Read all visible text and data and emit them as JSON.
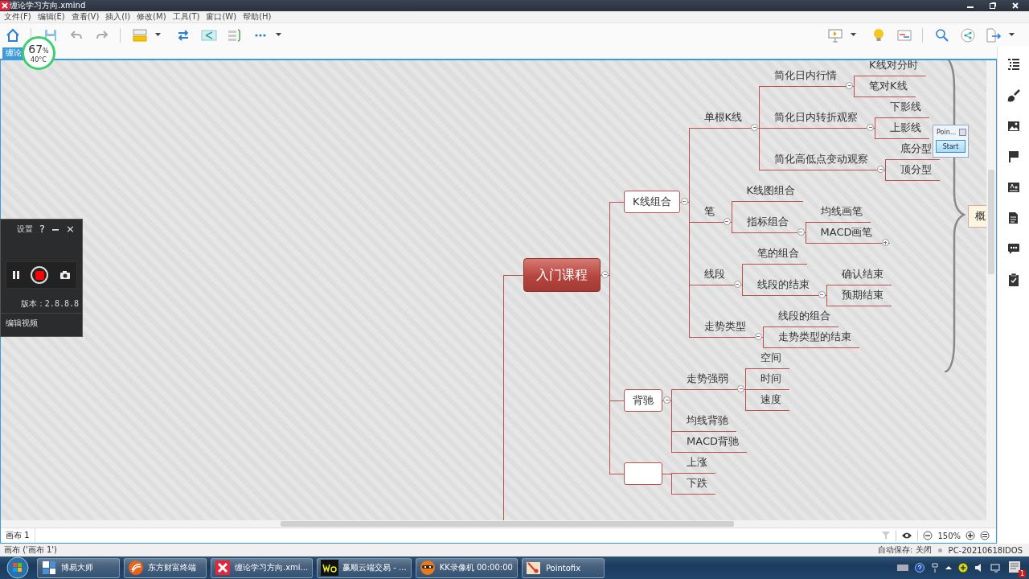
{
  "window": {
    "title": "缠论学习方向.xmind"
  },
  "menu": [
    "文件(F)",
    "编辑(E)",
    "查看(V)",
    "插入(I)",
    "修改(M)",
    "工具(T)",
    "窗口(W)",
    "帮助(H)"
  ],
  "tab": {
    "label": "缠论",
    "selected": true
  },
  "monitor_widget": {
    "value": "67",
    "unit": "%",
    "temperature": "40°C"
  },
  "map": {
    "root": {
      "label": "入门课程",
      "expanded": true,
      "children": [
        {
          "label": "K线组合",
          "expanded": true,
          "children": [
            {
              "label": "单根K线",
              "expanded": true,
              "children": [
                {
                  "label": "简化日内行情",
                  "expanded": true,
                  "children": [
                    {
                      "label": "K线对分时"
                    },
                    {
                      "label": "笔对K线"
                    }
                  ]
                },
                {
                  "label": "简化日内转折观察",
                  "expanded": true,
                  "children": [
                    {
                      "label": "下影线"
                    },
                    {
                      "label": "上影线"
                    }
                  ]
                },
                {
                  "label": "简化高低点变动观察",
                  "expanded": true,
                  "children": [
                    {
                      "label": "底分型"
                    },
                    {
                      "label": "顶分型"
                    }
                  ]
                }
              ]
            },
            {
              "label": "笔",
              "expanded": true,
              "children": [
                {
                  "label": "K线图组合"
                },
                {
                  "label": "指标组合",
                  "expanded": true,
                  "children": [
                    {
                      "label": "均线画笔"
                    },
                    {
                      "label": "MACD画笔",
                      "expanded": false
                    }
                  ]
                }
              ]
            },
            {
              "label": "线段",
              "expanded": true,
              "children": [
                {
                  "label": "笔的组合"
                },
                {
                  "label": "线段的结束",
                  "expanded": true,
                  "children": [
                    {
                      "label": "确认结束"
                    },
                    {
                      "label": "预期结束"
                    }
                  ]
                }
              ]
            },
            {
              "label": "走势类型",
              "expanded": true,
              "children": [
                {
                  "label": "线段的组合"
                },
                {
                  "label": "走势类型的结束"
                }
              ]
            }
          ]
        },
        {
          "label": "背驰",
          "expanded": true,
          "children": [
            {
              "label": "走势强弱",
              "expanded": true,
              "children": [
                {
                  "label": "空间"
                },
                {
                  "label": "时间"
                },
                {
                  "label": "速度"
                }
              ]
            },
            {
              "label": "均线背驰"
            },
            {
              "label": "MACD背驰"
            }
          ]
        },
        {
          "children": [
            {
              "label": "上涨"
            },
            {
              "label": "下跌"
            }
          ]
        }
      ]
    },
    "summary": {
      "label": "概"
    }
  },
  "sheet_tabs": [
    {
      "label": "画布 1",
      "selected": true
    }
  ],
  "zoom": "150%",
  "status": {
    "sheet": "画布 ('画布 1')",
    "autosave": "自动保存: 关闭",
    "computer": "PC-20210618IDOS"
  },
  "recorder": {
    "settings": "设置",
    "help": "?",
    "close": "×",
    "version": "版本：2.8.8.8",
    "edit_video": "编辑视频"
  },
  "pointofix": {
    "title": "Poin...",
    "button": "Start"
  },
  "taskbar": {
    "tasks": [
      {
        "label": "博易大师",
        "kind": "boyi"
      },
      {
        "label": "东方财富终端",
        "kind": "eastmoney"
      },
      {
        "label": "缠论学习方向.xmi...",
        "kind": "xmind"
      },
      {
        "label": "赢顺云端交易 - ...",
        "kind": "wh6"
      },
      {
        "label": "KK录像机 00:00:00",
        "kind": "kk"
      },
      {
        "label": "Pointofix",
        "kind": "pointofix"
      }
    ],
    "notification_badge": "1"
  }
}
